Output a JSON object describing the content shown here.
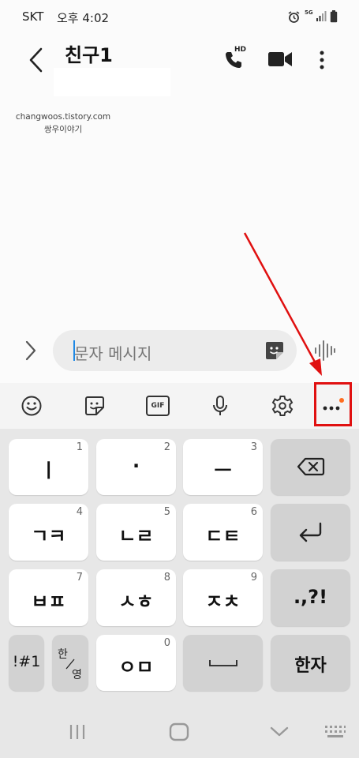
{
  "status": {
    "carrier": "SKT",
    "time": "오후 4:02",
    "network": "5G"
  },
  "header": {
    "title": "친구1",
    "call_badge": "HD"
  },
  "watermark": {
    "line1": "changwoos.tistory.com",
    "line2": "쌍우이야기"
  },
  "input": {
    "placeholder": "문자 메시지"
  },
  "toolbar": {
    "gif_label": "GIF"
  },
  "keyboard": {
    "keys": [
      {
        "main": "ㅣ",
        "num": "1"
      },
      {
        "main": "·",
        "num": "2"
      },
      {
        "main": "ㅡ",
        "num": "3"
      },
      {
        "main": "ㄱㅋ",
        "num": "4"
      },
      {
        "main": "ㄴㄹ",
        "num": "5"
      },
      {
        "main": "ㄷㅌ",
        "num": "6"
      },
      {
        "main": "ㅂㅍ",
        "num": "7"
      },
      {
        "main": "ㅅㅎ",
        "num": "8"
      },
      {
        "main": "ㅈㅊ",
        "num": "9"
      },
      {
        "main": "ㅇㅁ",
        "num": "0"
      }
    ],
    "punct": ".,?!",
    "symbols": "!#1",
    "lang_top": "한",
    "lang_bottom": "영",
    "hanja": "한자"
  },
  "colors": {
    "annotation": "#e01010",
    "badge_dot": "#ff6d1f",
    "cursor": "#1e88e5"
  }
}
